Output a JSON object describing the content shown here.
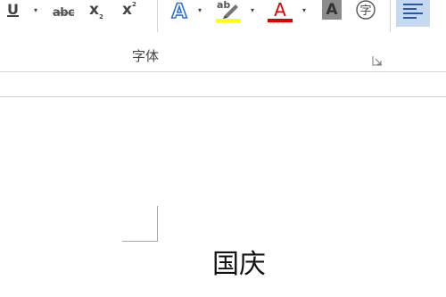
{
  "ribbon": {
    "font_group": {
      "label": "字体",
      "underline_glyph": "U",
      "strikethrough_glyph": "abc",
      "subscript_glyph": "x",
      "subscript_mark": "2",
      "superscript_glyph": "x",
      "superscript_mark": "2",
      "text_effects_glyph": "A",
      "highlight_glyph": "ab",
      "font_color_glyph": "A",
      "char_shading_glyph": "A",
      "enclose_char_glyph": "字"
    },
    "colors": {
      "highlight_yellow": "#ffff00",
      "font_color_red": "#e00000",
      "text_effects_blue": "#2e6fd6",
      "selected_button_bg": "#c5d9f1"
    },
    "icons": {
      "dropdown": "chevron-down-icon",
      "dialog_launcher": "dialog-launcher-icon",
      "align_left": "align-left-icon"
    }
  },
  "document": {
    "text": "国庆"
  }
}
